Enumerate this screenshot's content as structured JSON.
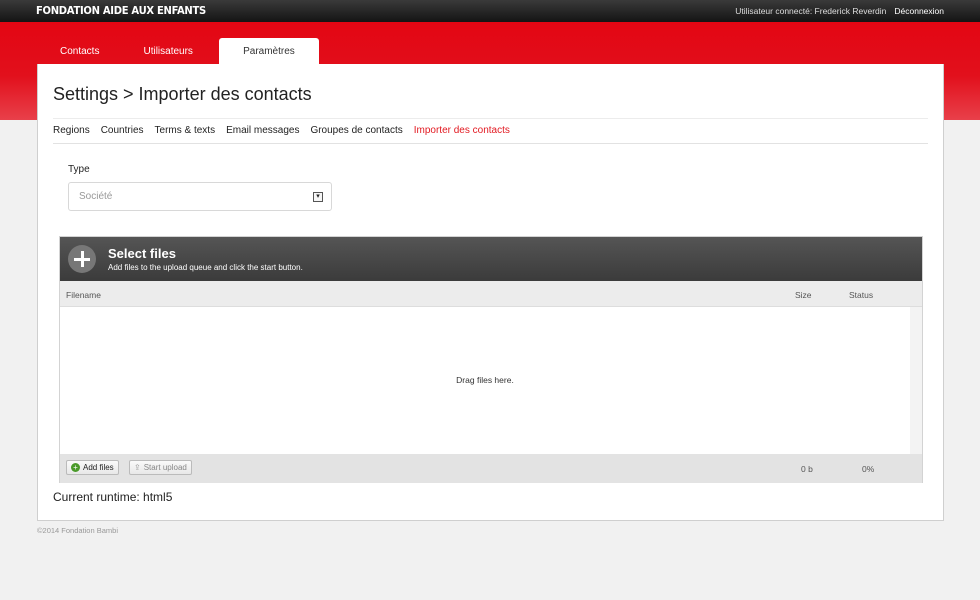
{
  "header": {
    "brand": "FONDATION AIDE AUX ENFANTS",
    "user_label": "Utilisateur connecté: Frederick Reverdin",
    "logout": "Déconnexion"
  },
  "tabs": [
    {
      "label": "Contacts",
      "active": false
    },
    {
      "label": "Utilisateurs",
      "active": false
    },
    {
      "label": "Paramètres",
      "active": true
    }
  ],
  "page": {
    "title": "Settings > Importer des contacts"
  },
  "subnav": [
    {
      "label": "Regions",
      "active": false
    },
    {
      "label": "Countries",
      "active": false
    },
    {
      "label": "Terms & texts",
      "active": false
    },
    {
      "label": "Email messages",
      "active": false
    },
    {
      "label": "Groupes de contacts",
      "active": false
    },
    {
      "label": "Importer des contacts",
      "active": true
    }
  ],
  "form": {
    "type_label": "Type",
    "type_value": "Société"
  },
  "uploader": {
    "title": "Select files",
    "subtitle": "Add files to the upload queue and click the start button.",
    "col_filename": "Filename",
    "col_size": "Size",
    "col_status": "Status",
    "drop_text": "Drag files here.",
    "add_button": "Add files",
    "start_button": "Start upload",
    "total_size": "0 b",
    "total_status": "0%"
  },
  "runtime": "Current runtime: html5",
  "footer": "©2014 Fondation Bambi",
  "colors": {
    "accent_red": "#e30613",
    "active_link": "#e21a22"
  },
  "icons": {
    "plus": "plus-circle-icon",
    "add": "add-circle-icon",
    "upload": "upload-arrow-icon",
    "dropdown": "dropdown-arrow-icon"
  }
}
